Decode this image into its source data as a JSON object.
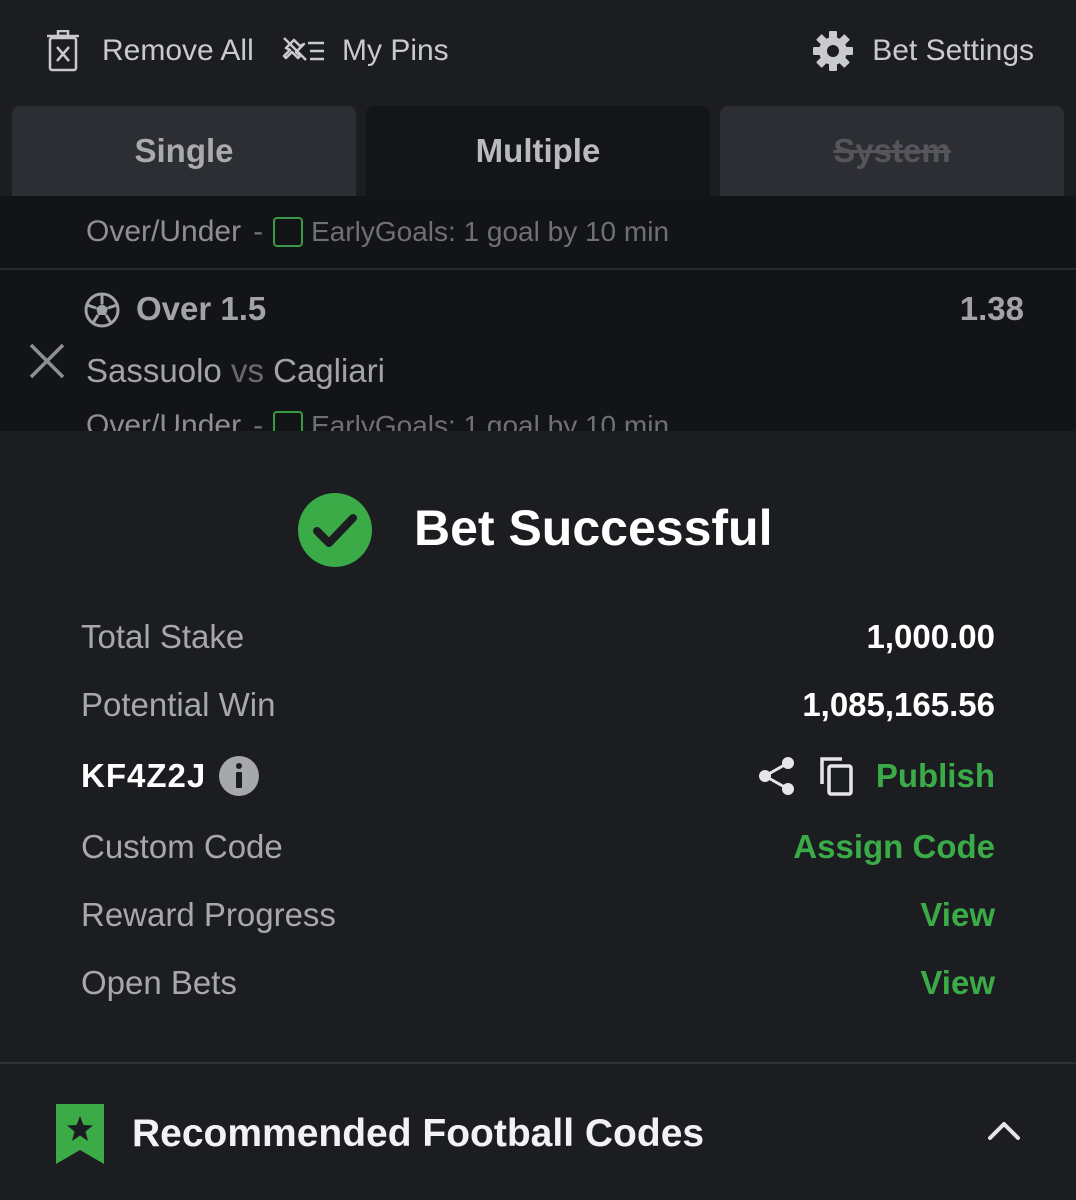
{
  "toolbar": {
    "remove_all": "Remove All",
    "my_pins": "My Pins",
    "bet_settings": "Bet Settings"
  },
  "tabs": {
    "single": "Single",
    "multiple": "Multiple",
    "system": "System"
  },
  "bets": [
    {
      "market": "Over/Under",
      "dash": "-",
      "tag": "EarlyGoals: 1 goal by 10 min"
    },
    {
      "selection": "Over 1.5",
      "odds": "1.38",
      "home": "Sassuolo",
      "vs": "vs",
      "away": "Cagliari",
      "market": "Over/Under",
      "dash": "-",
      "tag": "EarlyGoals: 1 goal by 10 min"
    }
  ],
  "success": {
    "title": "Bet Successful",
    "total_stake_label": "Total Stake",
    "total_stake": "1,000.00",
    "potential_win_label": "Potential Win",
    "potential_win": "1,085,165.56",
    "booking_code": "KF4Z2J",
    "publish": "Publish",
    "custom_code_label": "Custom Code",
    "assign_code": "Assign Code",
    "reward_progress_label": "Reward Progress",
    "reward_view": "View",
    "open_bets_label": "Open Bets",
    "open_bets_view": "View"
  },
  "recommended": {
    "title": "Recommended Football Codes"
  },
  "colors": {
    "accent_green": "#3bab48",
    "background": "#1c1d21",
    "dim_background": "#131417"
  },
  "icons": [
    "trash-icon",
    "pin-icon",
    "gear-icon",
    "football-icon",
    "close-icon",
    "check-circle-icon",
    "info-icon",
    "share-icon",
    "copy-icon",
    "bookmark-star-icon",
    "chevron-up-icon"
  ]
}
